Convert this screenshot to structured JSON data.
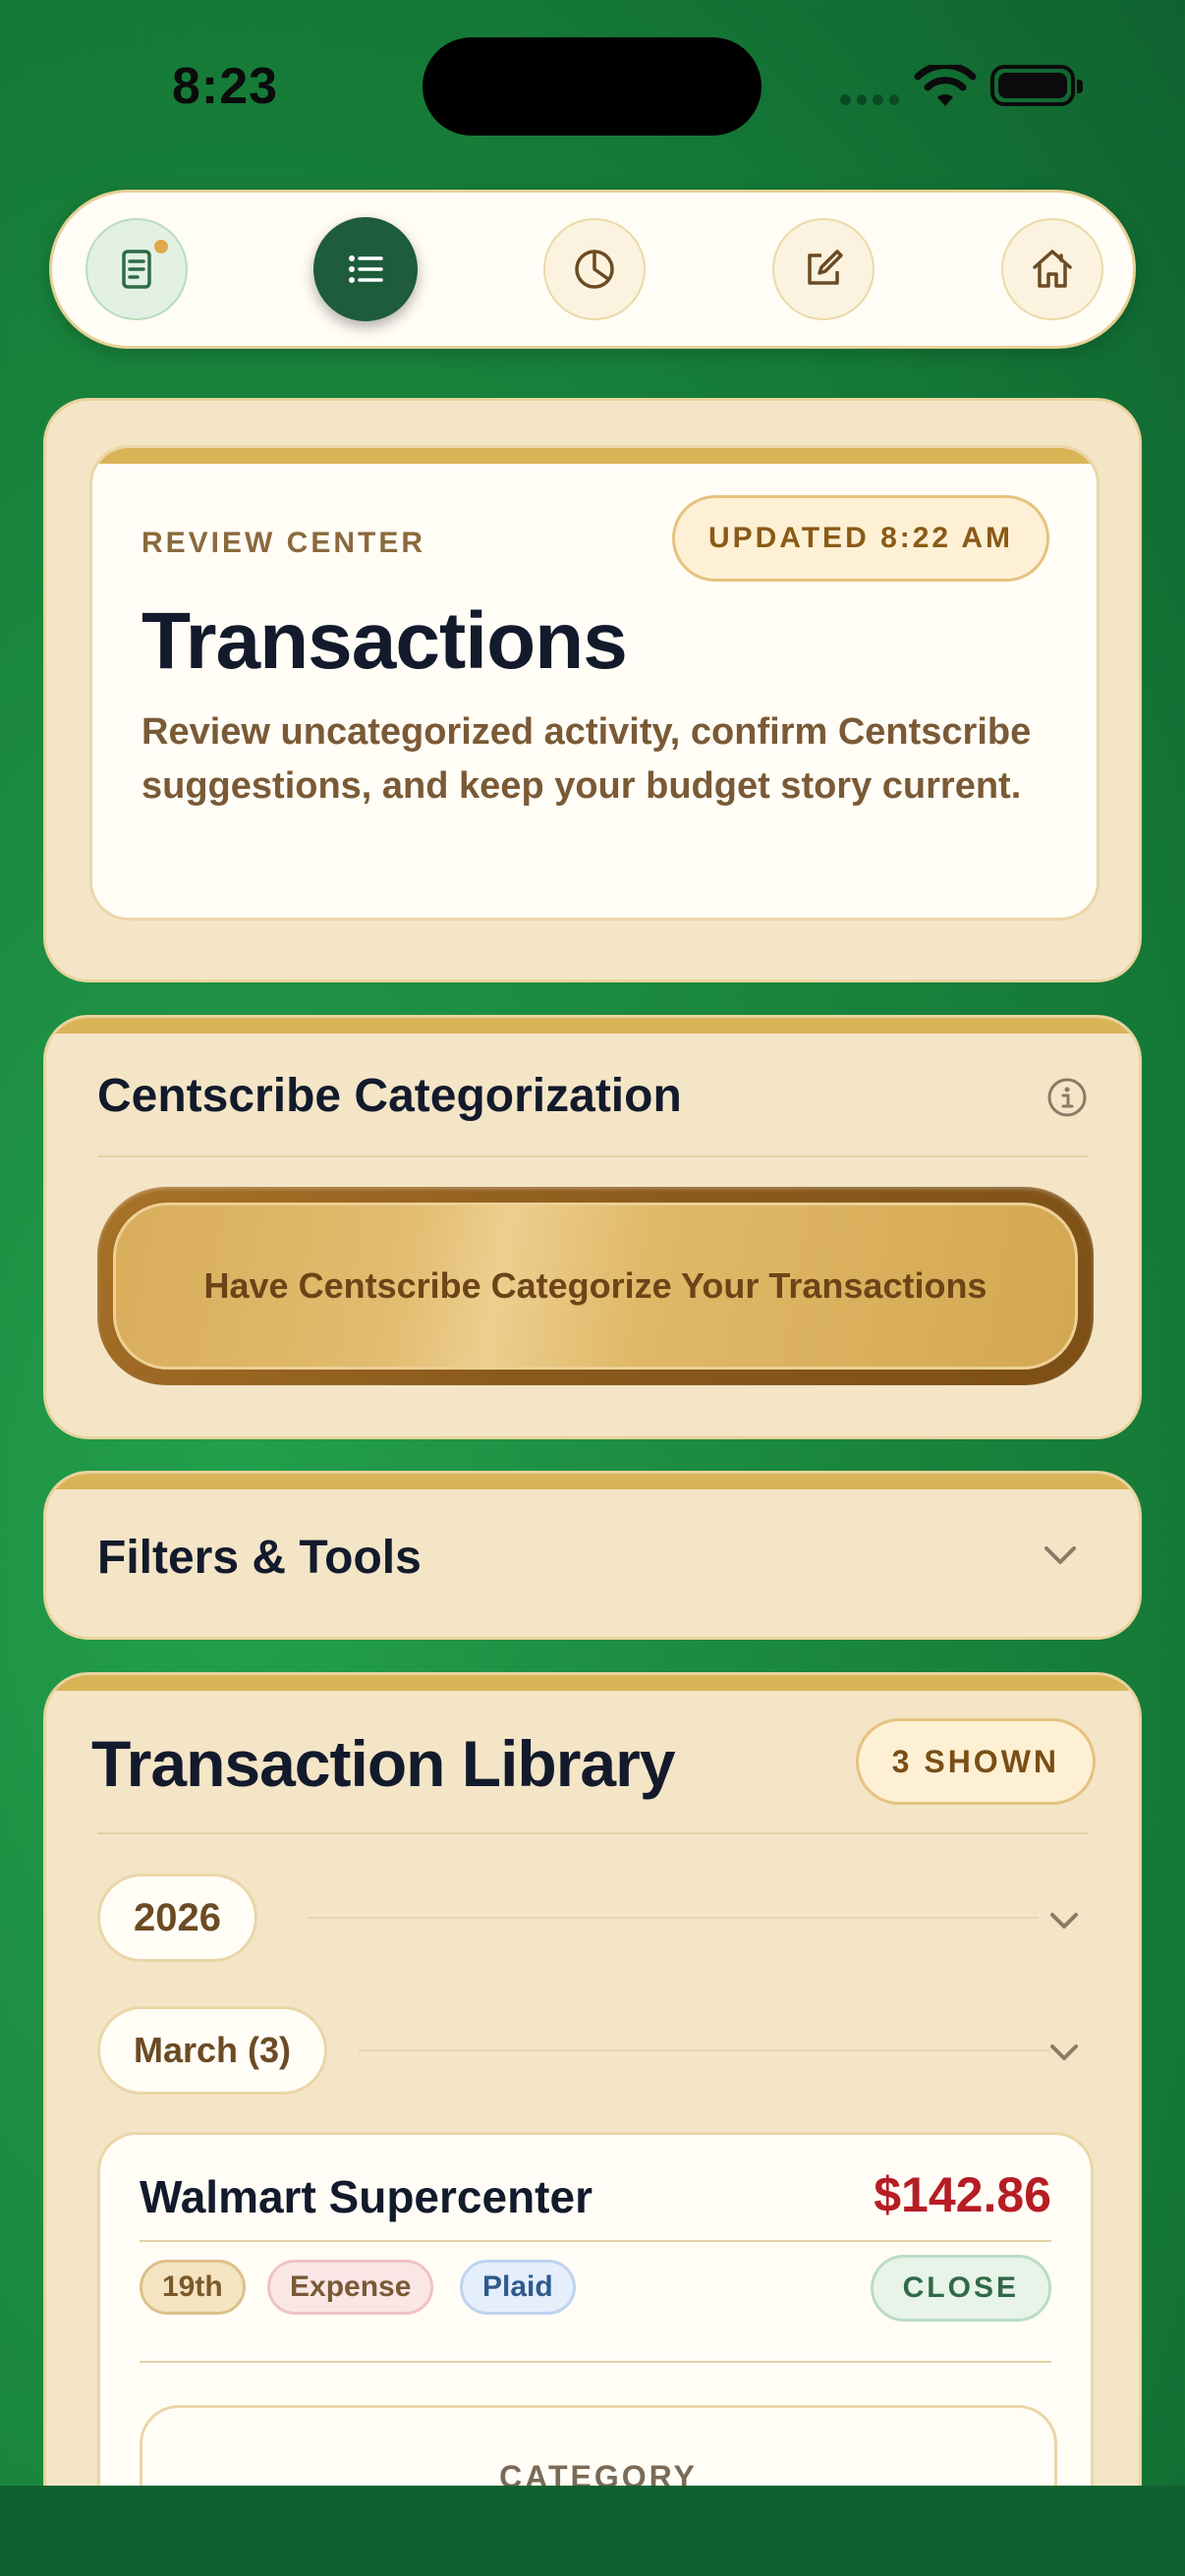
{
  "status_bar": {
    "time": "8:23"
  },
  "nav": {
    "items": [
      {
        "icon": "receipt-icon",
        "active": false
      },
      {
        "icon": "list-icon",
        "active": true
      },
      {
        "icon": "pie-chart-icon",
        "active": false
      },
      {
        "icon": "edit-icon",
        "active": false
      },
      {
        "icon": "home-icon",
        "active": false
      }
    ]
  },
  "hero": {
    "eyebrow": "REVIEW CENTER",
    "updated_badge": "UPDATED 8:22 AM",
    "title": "Transactions",
    "description": "Review uncategorized activity, confirm Centscribe suggestions, and keep your budget story current."
  },
  "categorization": {
    "title": "Centscribe Categorization",
    "button_label": "Have Centscribe Categorize Your Transactions"
  },
  "filters": {
    "title": "Filters & Tools"
  },
  "library": {
    "title": "Transaction Library",
    "shown_badge": "3 SHOWN",
    "year": "2026",
    "month": "March (3)",
    "transactions": [
      {
        "name": "Walmart Supercenter",
        "amount": "$142.86",
        "date_tag": "19th",
        "type_tag": "Expense",
        "source_tag": "Plaid",
        "action_label": "CLOSE",
        "category_label": "CATEGORY"
      }
    ]
  },
  "colors": {
    "background_green": "#1c8b40",
    "card_cream": "#f3e5c6",
    "accent_gold": "#d9b457",
    "nav_active": "#1e5c3c",
    "amount_red": "#b61d24"
  }
}
